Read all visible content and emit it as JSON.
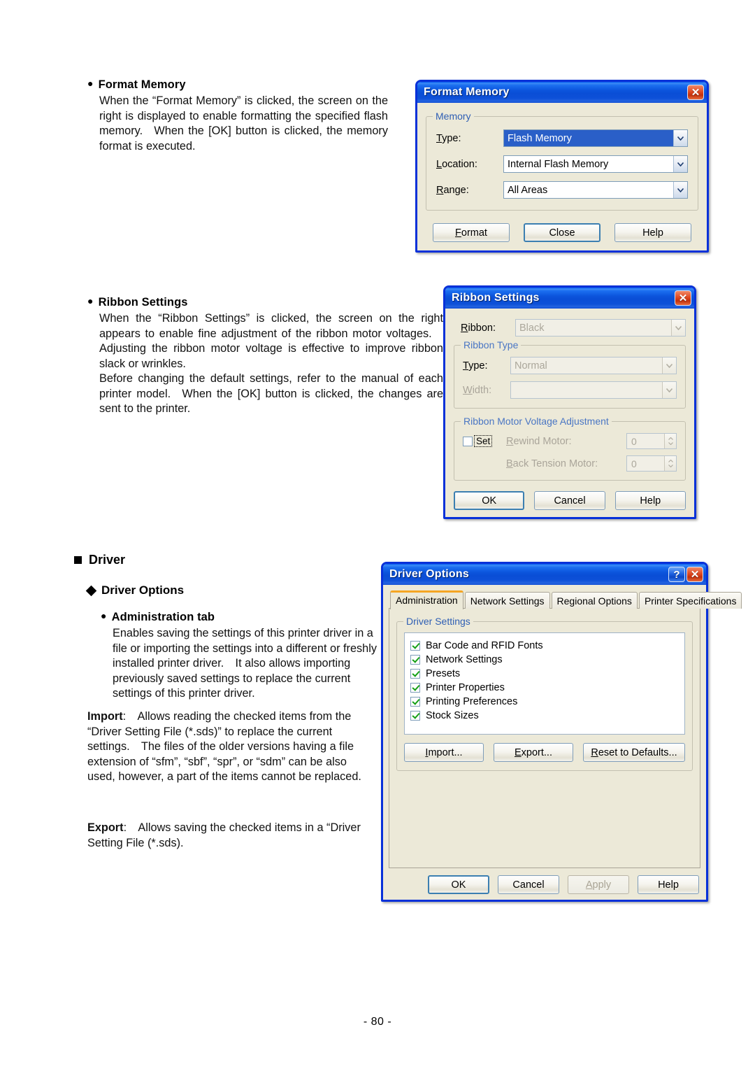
{
  "page": {
    "footer": "- 80 -",
    "sections": {
      "format_memory": {
        "heading": "Format Memory",
        "paragraphs": [
          "When the “Format Memory” is clicked, the screen on the right is displayed to enable formatting the specified flash memory. When the [OK] button is clicked, the memory format is executed."
        ]
      },
      "ribbon_settings": {
        "heading": "Ribbon Settings",
        "paragraphs": [
          "When the “Ribbon Settings” is clicked, the screen on the right appears to enable fine adjustment of the ribbon motor voltages. Adjusting the ribbon motor voltage is effective to improve ribbon slack or wrinkles.",
          "Before changing the default settings, refer to the manual of each printer model. When the [OK] button is clicked, the changes are sent to the printer."
        ]
      },
      "driver": {
        "heading": "Driver",
        "subheading": "Driver Options",
        "item_heading": "Administration tab",
        "paragraphs": [
          "Enables saving the settings of this printer driver in a file or importing the settings into a different or freshly installed printer driver. It also allows importing previously saved settings to replace the current settings of this printer driver."
        ],
        "import_label": "Import",
        "import_text": ": Allows reading the checked items from the “Driver Setting File (*.sds)” to replace the current settings. The files of the older versions having a file extension of “sfm”, “sbf”, “spr”, or “sdm” can be also used, however, a part of the items cannot be replaced.",
        "export_label": "Export",
        "export_text": ": Allows saving the checked items in a “Driver Setting File (*.sds)."
      }
    }
  },
  "format_memory_dialog": {
    "title": "Format Memory",
    "close_label": "✕",
    "group_label": "Memory",
    "fields": [
      {
        "label": "Type:",
        "label_mnemonic": "T",
        "value": "Flash Memory",
        "selected": true
      },
      {
        "label": "Location:",
        "label_mnemonic": "L",
        "value": "Internal Flash Memory",
        "selected": false
      },
      {
        "label": "Range:",
        "label_mnemonic": "R",
        "value": "All Areas",
        "selected": false
      }
    ],
    "buttons": [
      {
        "label": "Format",
        "mnemonic": "F",
        "default": false,
        "disabled": false
      },
      {
        "label": "Close",
        "mnemonic": "",
        "default": true,
        "disabled": false
      },
      {
        "label": "Help",
        "mnemonic": "",
        "default": false,
        "disabled": false
      }
    ]
  },
  "ribbon_settings_dialog": {
    "title": "Ribbon Settings",
    "close_label": "✕",
    "ribbon_label": "Ribbon:",
    "ribbon_value": "Black",
    "ribbon_type_group": "Ribbon Type",
    "type_label": "Type:",
    "type_value": "Normal",
    "width_label": "Width:",
    "width_value": "",
    "voltage_group": "Ribbon Motor Voltage Adjustment",
    "set_label": "Set",
    "set_checked": false,
    "rewind_label": "Rewind Motor:",
    "rewind_value": "0",
    "back_tension_label": "Back Tension Motor:",
    "back_tension_value": "0",
    "buttons": [
      {
        "label": "OK",
        "default": true,
        "disabled": false
      },
      {
        "label": "Cancel",
        "default": false,
        "disabled": false
      },
      {
        "label": "Help",
        "default": false,
        "disabled": false
      }
    ]
  },
  "driver_options_dialog": {
    "title": "Driver Options",
    "help_label": "?",
    "close_label": "✕",
    "tabs": [
      {
        "label": "Administration",
        "active": true
      },
      {
        "label": "Network Settings",
        "active": false
      },
      {
        "label": "Regional Options",
        "active": false
      },
      {
        "label": "Printer Specifications",
        "active": false
      }
    ],
    "group_label": "Driver Settings",
    "checkitems": [
      {
        "label": "Bar Code and RFID Fonts",
        "checked": true
      },
      {
        "label": "Network Settings",
        "checked": true
      },
      {
        "label": "Presets",
        "checked": true
      },
      {
        "label": "Printer Properties",
        "checked": true
      },
      {
        "label": "Printing Preferences",
        "checked": true
      },
      {
        "label": "Stock Sizes",
        "checked": true
      }
    ],
    "action_buttons": [
      {
        "label": "Import...",
        "mnemonic": "I"
      },
      {
        "label": "Export...",
        "mnemonic": "E"
      },
      {
        "label": "Reset to Defaults...",
        "mnemonic": "R"
      }
    ],
    "footer_buttons": [
      {
        "label": "OK",
        "default": true,
        "disabled": false
      },
      {
        "label": "Cancel",
        "default": false,
        "disabled": false
      },
      {
        "label": "Apply",
        "default": false,
        "disabled": true
      },
      {
        "label": "Help",
        "default": false,
        "disabled": false
      }
    ]
  },
  "colors": {
    "title_blue": "#0a4ed6",
    "dialog_face": "#ece9d8",
    "border_blue": "#0831d9",
    "group_label_blue": "#2f5fb4",
    "check_green": "#15a015",
    "active_tab_orange": "#f5a623",
    "selection_blue": "#2a5fc8"
  }
}
